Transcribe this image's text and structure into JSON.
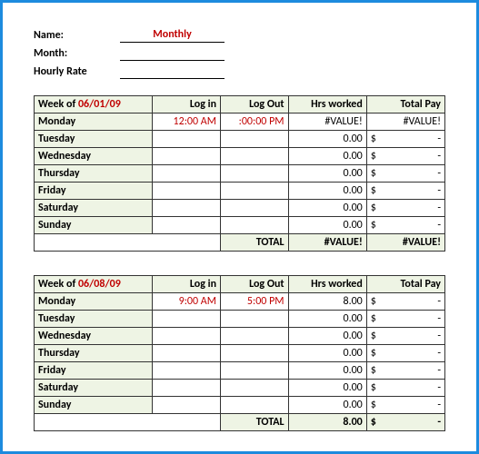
{
  "header": {
    "name_label": "Name:",
    "name_value": "Monthly",
    "month_label": "Month:",
    "month_value": "",
    "rate_label": "Hourly Rate",
    "rate_value": ""
  },
  "week1": {
    "week_label": "Week of ",
    "week_date": "06/01/09",
    "cols": {
      "login": "Log in",
      "logout": "Log Out",
      "hrs": "Hrs worked",
      "pay": "Total Pay"
    },
    "rows": [
      {
        "day": "Monday",
        "login": "12:00 AM",
        "logout": ":00:00 PM",
        "hrs": "#VALUE!",
        "cur": "",
        "amt": "#VALUE!"
      },
      {
        "day": "Tuesday",
        "login": "",
        "logout": "",
        "hrs": "0.00",
        "cur": "$",
        "amt": "-"
      },
      {
        "day": "Wednesday",
        "login": "",
        "logout": "",
        "hrs": "0.00",
        "cur": "$",
        "amt": "-"
      },
      {
        "day": "Thursday",
        "login": "",
        "logout": "",
        "hrs": "0.00",
        "cur": "$",
        "amt": "-"
      },
      {
        "day": "Friday",
        "login": "",
        "logout": "",
        "hrs": "0.00",
        "cur": "$",
        "amt": "-"
      },
      {
        "day": "Saturday",
        "login": "",
        "logout": "",
        "hrs": "0.00",
        "cur": "$",
        "amt": "-"
      },
      {
        "day": "Sunday",
        "login": "",
        "logout": "",
        "hrs": "0.00",
        "cur": "$",
        "amt": "-"
      }
    ],
    "total_label": "TOTAL",
    "total_hrs": "#VALUE!",
    "total_cur": "",
    "total_amt": "#VALUE!"
  },
  "week2": {
    "week_label": "Week of ",
    "week_date": "06/08/09",
    "cols": {
      "login": "Log in",
      "logout": "Log Out",
      "hrs": "Hrs worked",
      "pay": "Total Pay"
    },
    "rows": [
      {
        "day": "Monday",
        "login": "9:00 AM",
        "logout": "5:00 PM",
        "hrs": "8.00",
        "cur": "$",
        "amt": "-"
      },
      {
        "day": "Tuesday",
        "login": "",
        "logout": "",
        "hrs": "0.00",
        "cur": "$",
        "amt": "-"
      },
      {
        "day": "Wednesday",
        "login": "",
        "logout": "",
        "hrs": "0.00",
        "cur": "$",
        "amt": "-"
      },
      {
        "day": "Thursday",
        "login": "",
        "logout": "",
        "hrs": "0.00",
        "cur": "$",
        "amt": "-"
      },
      {
        "day": "Friday",
        "login": "",
        "logout": "",
        "hrs": "0.00",
        "cur": "$",
        "amt": "-"
      },
      {
        "day": "Saturday",
        "login": "",
        "logout": "",
        "hrs": "0.00",
        "cur": "$",
        "amt": "-"
      },
      {
        "day": "Sunday",
        "login": "",
        "logout": "",
        "hrs": "0.00",
        "cur": "$",
        "amt": "-"
      }
    ],
    "total_label": "TOTAL",
    "total_hrs": "8.00",
    "total_cur": "$",
    "total_amt": "-"
  }
}
